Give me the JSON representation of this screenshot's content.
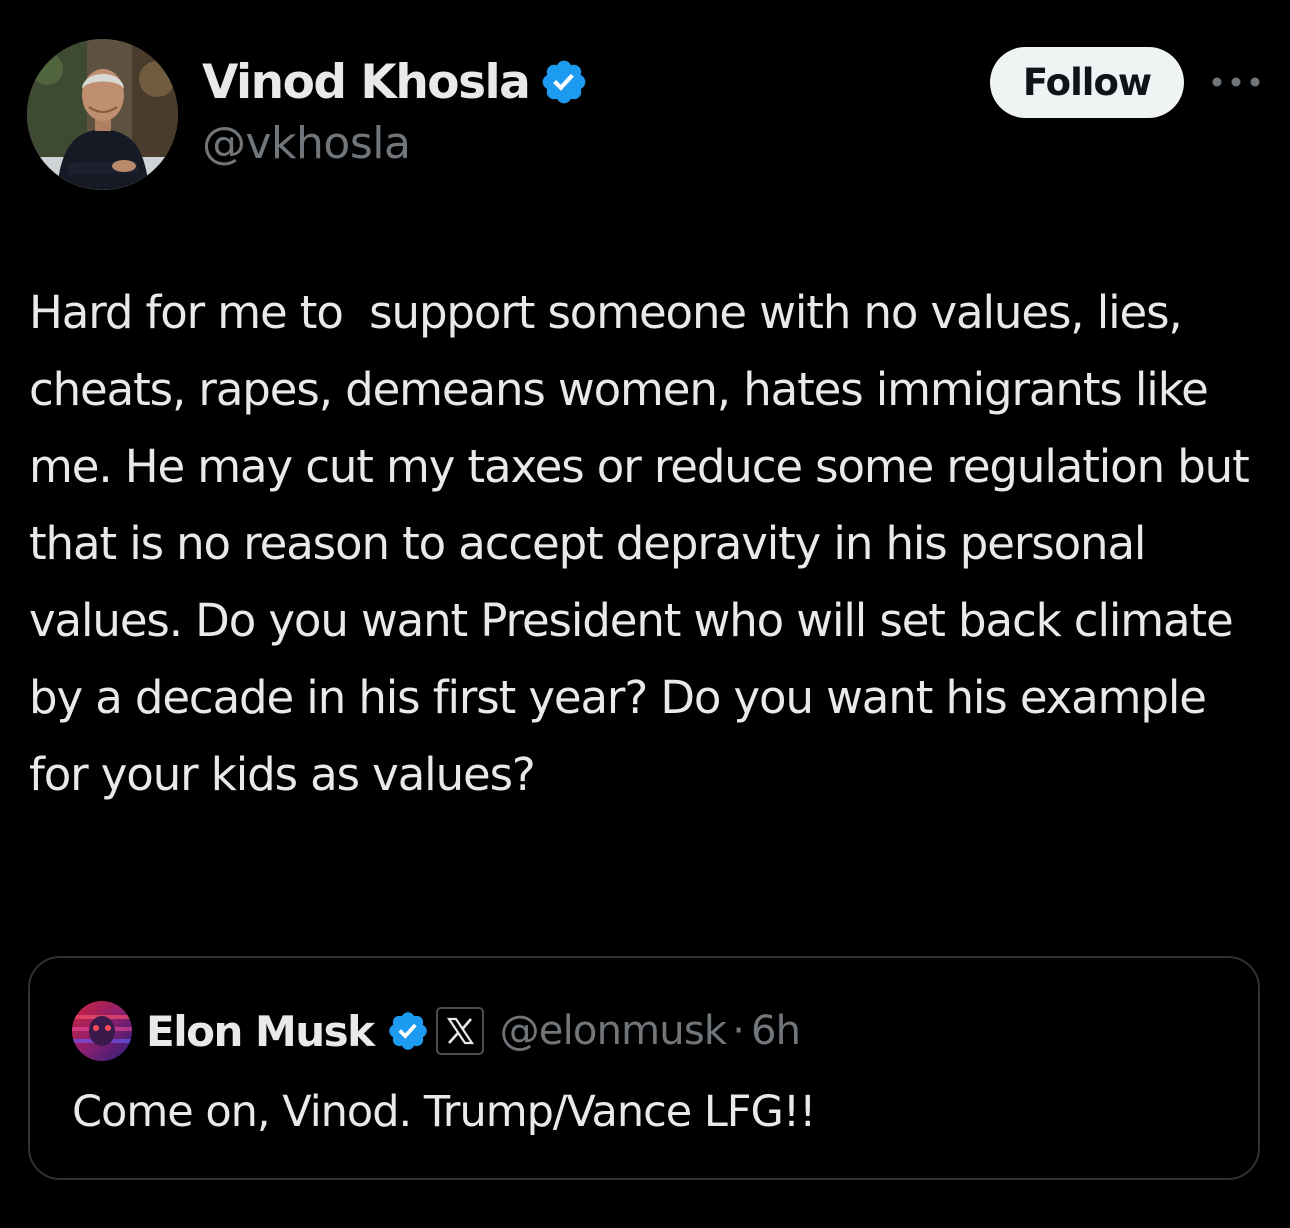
{
  "tweet": {
    "author": {
      "name": "Vinod Khosla",
      "handle": "@vkhosla",
      "verified": true,
      "avatar_icon": "profile-photo"
    },
    "follow_label": "Follow",
    "more_icon": "more-horizontal-icon",
    "text": "Hard for me to  support someone with no values, lies, cheats, rapes, demeans women, hates immigrants like me. He may cut my taxes or reduce some regulation but that is no reason to accept depravity in his personal values. Do you want President who will set back climate by a decade in his first year? Do you want his example for your kids as values?"
  },
  "quote": {
    "author": {
      "name": "Elon Musk",
      "handle": "@elonmusk",
      "verified": true,
      "affiliation_icon": "x-logo-icon",
      "avatar_icon": "profile-photo"
    },
    "separator": "·",
    "time": "6h",
    "text": "Come on, Vinod. Trump/Vance LFG!!"
  },
  "colors": {
    "background": "#000000",
    "text_primary": "#e7e9ea",
    "text_secondary": "#71767b",
    "verified_blue": "#1d9bf0",
    "border": "#2f3336",
    "follow_bg": "#eff3f4"
  }
}
